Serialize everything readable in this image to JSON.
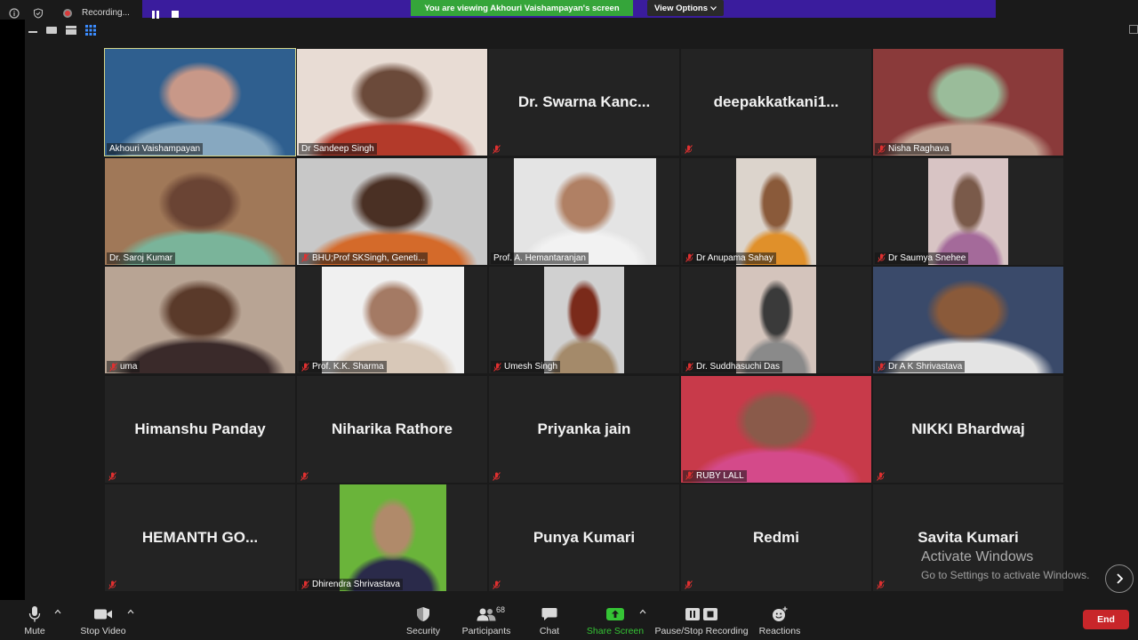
{
  "topbar": {
    "recording_label": "Recording...",
    "viewing_banner": "You are viewing Akhouri Vaishampayan's screen",
    "view_options_label": "View Options"
  },
  "participants_grid": [
    {
      "name": "Akhouri Vaishampayan",
      "video": true,
      "muted": false,
      "active": true,
      "colors": [
        "#2f5f8f",
        "#c89888",
        "#87a8c0"
      ]
    },
    {
      "name": "Dr Sandeep Singh",
      "video": true,
      "muted": false,
      "colors": [
        "#e8dcd4",
        "#6b4a3a",
        "#b33a2a"
      ]
    },
    {
      "name": "Dr. Swarna Kanc...",
      "video": false,
      "muted": true
    },
    {
      "name": "deepakkatkani1...",
      "video": false,
      "muted": true
    },
    {
      "name": "Nisha Raghava",
      "video": true,
      "muted": true,
      "colors": [
        "#8a3a3a",
        "#9abc9a",
        "#c4a494"
      ]
    },
    {
      "name": "Dr. Saroj Kumar",
      "video": true,
      "muted": false,
      "colors": [
        "#a07858",
        "#6a4434",
        "#7ab49a"
      ]
    },
    {
      "name": "BHU;Prof SKSingh, Geneti...",
      "video": true,
      "muted": true,
      "colors": [
        "#c8c8c8",
        "#4a3024",
        "#d46a2a"
      ]
    },
    {
      "name": "Prof. A. Hemantaranjan",
      "video": true,
      "muted": false,
      "colors": [
        "#e4e4e4",
        "#b08064",
        "#f2f2f2"
      ]
    },
    {
      "name": "Dr Anupama Sahay",
      "video": true,
      "muted": true,
      "colors": [
        "#dcd4cc",
        "#8a5a3a",
        "#e0902a"
      ]
    },
    {
      "name": "Dr Saumya Snehee",
      "video": true,
      "muted": true,
      "colors": [
        "#d8c4c4",
        "#7a5a4a",
        "#a46a9a"
      ]
    },
    {
      "name": "uma",
      "video": true,
      "muted": true,
      "colors": [
        "#b8a494",
        "#5a3a2a",
        "#3a2a2a"
      ]
    },
    {
      "name": "Prof. K.K. Sharma",
      "video": true,
      "muted": true,
      "colors": [
        "#f0f0f0",
        "#a47a64",
        "#d8c8b8"
      ]
    },
    {
      "name": "Umesh Singh",
      "video": true,
      "muted": true,
      "colors": [
        "#d0d0d0",
        "#7a2a1a",
        "#a48a6a"
      ]
    },
    {
      "name": "Dr. Suddhasuchi Das",
      "video": true,
      "muted": true,
      "colors": [
        "#d4c4bc",
        "#3a3a3a",
        "#8a8a8a"
      ]
    },
    {
      "name": "Dr A K Shrivastava",
      "video": true,
      "muted": true,
      "colors": [
        "#3a4a6a",
        "#8a5a3a",
        "#e4e4e4"
      ]
    },
    {
      "name": "Himanshu Panday",
      "video": false,
      "muted": true
    },
    {
      "name": "Niharika Rathore",
      "video": false,
      "muted": true
    },
    {
      "name": "Priyanka jain",
      "video": false,
      "muted": true
    },
    {
      "name": "RUBY LALL",
      "video": true,
      "muted": true,
      "colors": [
        "#c83a4a",
        "#8a5a4a",
        "#d44a8a"
      ]
    },
    {
      "name": "NIKKI Bhardwaj",
      "video": false,
      "muted": true
    },
    {
      "name": "HEMANTH  GO...",
      "video": false,
      "muted": true
    },
    {
      "name": "Dhirendra Shrivastava",
      "video": true,
      "muted": true,
      "colors": [
        "#6ab43a",
        "#b08a6a",
        "#2a2a4a"
      ]
    },
    {
      "name": "Punya Kumari",
      "video": false,
      "muted": true
    },
    {
      "name": "Redmi",
      "video": false,
      "muted": true
    },
    {
      "name": "Savita Kumari",
      "video": false,
      "muted": true
    }
  ],
  "watermark": {
    "title": "Activate Windows",
    "subtitle": "Go to Settings to activate Windows."
  },
  "toolbar": {
    "mute": "Mute",
    "stop_video": "Stop Video",
    "security": "Security",
    "participants": "Participants",
    "participants_count": "68",
    "chat": "Chat",
    "share_screen": "Share Screen",
    "pause_stop_recording": "Pause/Stop Recording",
    "reactions": "Reactions",
    "end": "End"
  },
  "colors": {
    "share_green": "#35c435",
    "end_red": "#c8262a",
    "banner_green": "#35a53a",
    "banner_purple": "#3a1c9d"
  }
}
